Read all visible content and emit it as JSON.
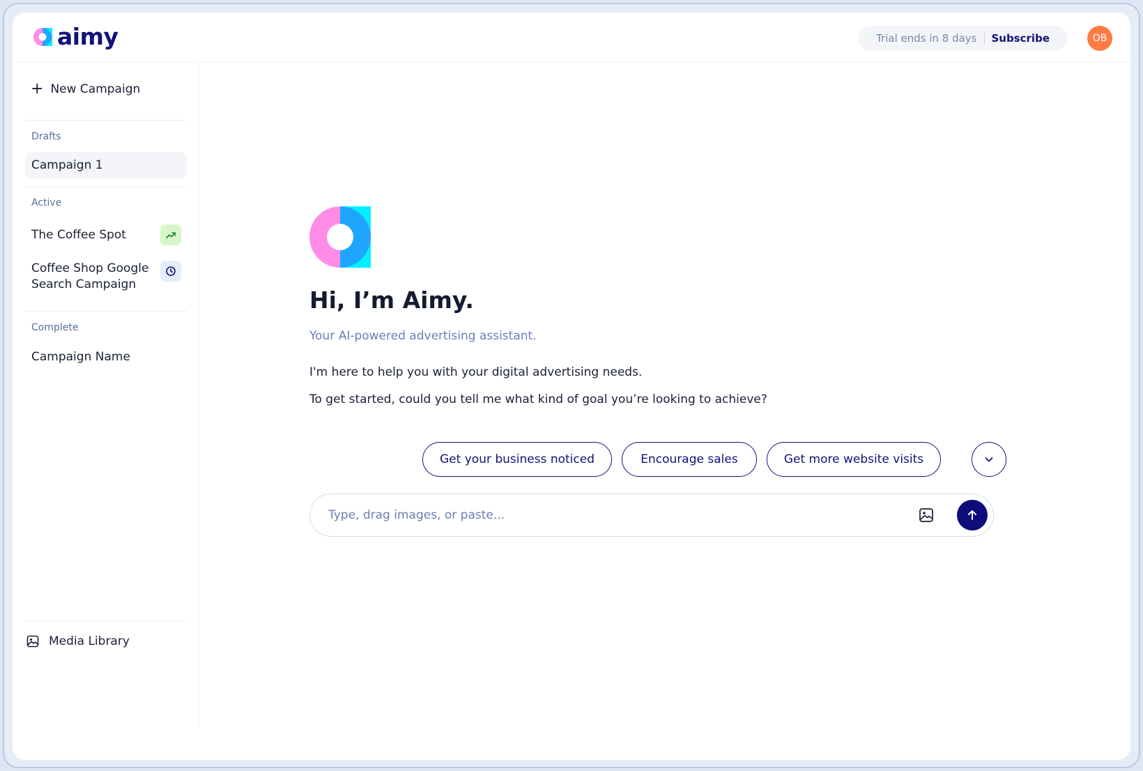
{
  "brand": {
    "name": "aimy",
    "primary_color": "#12127a",
    "logo_pink": "#ff8de8",
    "logo_blue": "#1ea6ff",
    "logo_cyan": "#00f0ff"
  },
  "header": {
    "trial_text": "Trial ends in 8 days",
    "subscribe_label": "Subscribe",
    "avatar_initials": "OB"
  },
  "sidebar": {
    "new_campaign_label": "New Campaign",
    "sections": {
      "drafts": {
        "label": "Drafts",
        "items": [
          {
            "label": "Campaign 1"
          }
        ]
      },
      "active": {
        "label": "Active",
        "items": [
          {
            "label": "The Coffee Spot",
            "icon": "trending-up-icon"
          },
          {
            "label": "Coffee Shop Google Search Campaign",
            "line1": "Coffee Shop Google",
            "line2": "Search Campaign",
            "icon": "clock-icon"
          }
        ]
      },
      "complete": {
        "label": "Complete",
        "items": [
          {
            "label": "Campaign Name"
          }
        ]
      }
    },
    "media_library_label": "Media Library"
  },
  "main": {
    "greeting": "Hi, I’m Aimy.",
    "tagline": "Your AI-powered advertising assistant.",
    "paragraphs": [
      "I'm here to help you with your digital advertising needs.",
      "To get started, could you tell me what kind of goal you’re looking to achieve?"
    ],
    "suggestions": [
      "Get your business noticed",
      "Encourage sales",
      "Get more website visits"
    ],
    "composer": {
      "placeholder": "Type, drag images, or paste...",
      "value": ""
    }
  }
}
